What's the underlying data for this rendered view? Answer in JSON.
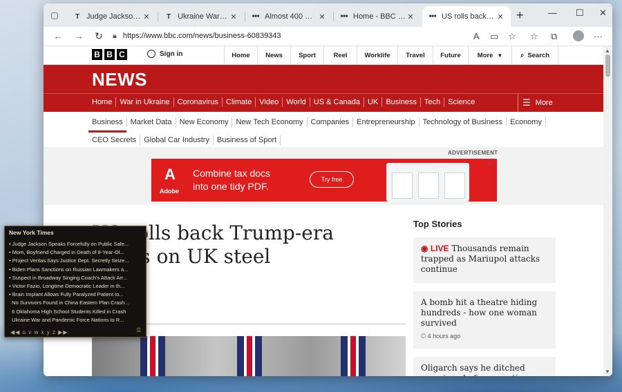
{
  "browser": {
    "tabs": [
      {
        "title": "Judge Jackson Speaks F",
        "favicon": "T"
      },
      {
        "title": "Ukraine War and Pande",
        "favicon": "T"
      },
      {
        "title": "Almost 400 migrants c",
        "favicon": "■■■"
      },
      {
        "title": "Home - BBC News",
        "favicon": "■■■"
      },
      {
        "title": "US rolls back Trump-e",
        "favicon": "■■■",
        "active": true
      }
    ],
    "url": "https://www.bbc.com/news/business-60839343",
    "toolbar_icons": [
      "read-aloud-icon",
      "immersive-reader-icon",
      "favorites-add-icon",
      "favorites-icon",
      "collections-icon",
      "profile-icon",
      "menu-icon"
    ]
  },
  "bbc": {
    "logo": [
      "B",
      "B",
      "C"
    ],
    "signin": "Sign in",
    "topnav": [
      "Home",
      "News",
      "Sport",
      "Reel",
      "Worklife",
      "Travel",
      "Future",
      "More",
      "Search"
    ],
    "news_title": "NEWS",
    "sections": [
      "Home",
      "War in Ukraine",
      "Coronavirus",
      "Climate",
      "Video",
      "World",
      "US & Canada",
      "UK",
      "Business",
      "Tech",
      "Science"
    ],
    "more": "More",
    "subnav_row1": [
      "Business",
      "Market Data",
      "New Economy",
      "New Tech Economy",
      "Companies",
      "Entrepreneurship",
      "Technology of Business",
      "Economy"
    ],
    "subnav_row2": [
      "CEO Secrets",
      "Global Car Industry",
      "Business of Sport"
    ],
    "ad_label": "ADVERTISEMENT",
    "ad": {
      "brand": "Adobe",
      "line1": "Combine tax docs",
      "line2": "into one tidy PDF.",
      "cta": "Try free"
    },
    "headline_line1": "US rolls back Trump-era",
    "headline_line2": "tariffs on UK steel",
    "top_stories_title": "Top Stories",
    "stories": [
      {
        "live": "LIVE",
        "headline": "Thousands remain trapped as Mariupol attacks continue",
        "meta": ""
      },
      {
        "live": "",
        "headline": "A bomb hit a theatre hiding hundreds - how one woman survived",
        "meta": "4 hours ago"
      },
      {
        "live": "",
        "headline": "Oligarch says he ditched mansions before sanctions",
        "meta": ""
      }
    ]
  },
  "widget": {
    "title": "New York Times",
    "items": [
      "Judge Jackson Speaks Forcefully on Public Safe...",
      "Mom, Boyfriend Charged in Death of 8-Year-Ol...",
      "Project Veritas Says Justice Dept. Secretly Seize...",
      "Biden Plans Sanctions on Russian Lawmakers a...",
      "Suspect in Broadway Singing Coach's Attack Arr...",
      "Victor Fazio, Longtime Democratic Leader in th...",
      "Brain Implant Allows Fully Paralyzed Patient to...",
      "No Survivors Found in China Eastern Plan Crash...",
      "6 Oklahoma High School Students Killed in Crash",
      "Ukraine War and Pandemic Force Nations to R..."
    ],
    "footer": "u v w x y z"
  }
}
